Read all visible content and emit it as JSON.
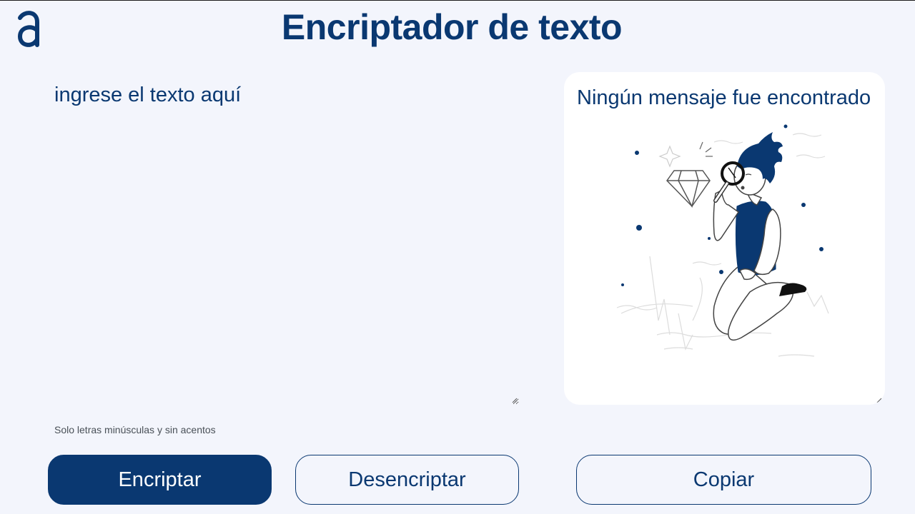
{
  "header": {
    "logo_icon": "alura-a-logo-icon",
    "title": "Encriptador de texto"
  },
  "input": {
    "placeholder": "ingrese el texto aquí",
    "value": "",
    "hint": "Solo letras minúsculas y sin acentos"
  },
  "output": {
    "empty_message": "Ningún mensaje fue encontrado",
    "illustration": "person-with-magnifying-glass-and-diamond"
  },
  "buttons": {
    "encrypt_label": "Encriptar",
    "decrypt_label": "Desencriptar",
    "copy_label": "Copiar"
  },
  "colors": {
    "primary": "#0a3871",
    "background": "#f3f5fc",
    "panel": "#ffffff",
    "hint_text": "#495057"
  }
}
